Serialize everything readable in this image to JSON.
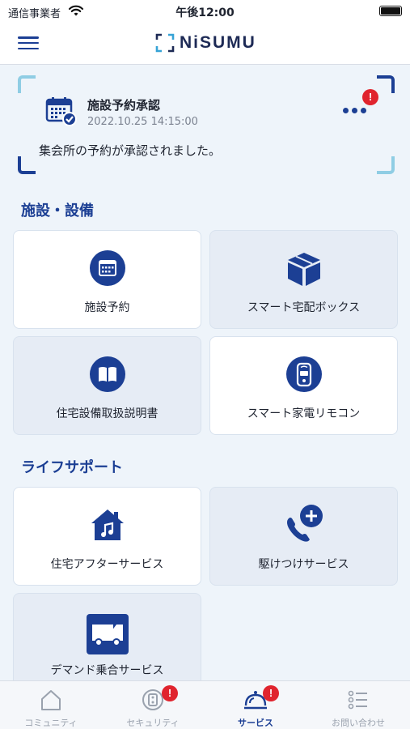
{
  "status_bar": {
    "carrier": "通信事業者",
    "time": "午後12:00"
  },
  "header": {
    "logo_text": "NiSUMU"
  },
  "notification": {
    "title": "施設予約承認",
    "timestamp": "2022.10.25 14:15:00",
    "message": "集会所の予約が承認されました。",
    "badge": "!"
  },
  "sections": [
    {
      "title": "施設・設備",
      "tiles": [
        {
          "label": "施設予約",
          "icon": "calendar-icon"
        },
        {
          "label": "スマート宅配ボックス",
          "icon": "box-icon"
        },
        {
          "label": "住宅設備取扱説明書",
          "icon": "book-icon"
        },
        {
          "label": "スマート家電リモコン",
          "icon": "remote-icon"
        }
      ]
    },
    {
      "title": "ライフサポート",
      "tiles": [
        {
          "label": "住宅アフターサービス",
          "icon": "house-music-icon"
        },
        {
          "label": "駆けつけサービス",
          "icon": "phone-plus-icon"
        },
        {
          "label": "デマンド乗合サービス",
          "icon": "bus-icon"
        }
      ]
    }
  ],
  "tabbar": {
    "tabs": [
      {
        "label": "コミュニティ",
        "icon": "community-icon",
        "active": false
      },
      {
        "label": "セキュリティ",
        "icon": "security-icon",
        "active": false,
        "badge": "!"
      },
      {
        "label": "サービス",
        "icon": "service-bell-icon",
        "active": true,
        "badge": "!"
      },
      {
        "label": "お問い合わせ",
        "icon": "list-icon",
        "active": false
      }
    ]
  },
  "colors": {
    "primary": "#1c3f94",
    "accent_light": "#8fcde4",
    "badge": "#e0242e",
    "background": "#eef4fa"
  }
}
